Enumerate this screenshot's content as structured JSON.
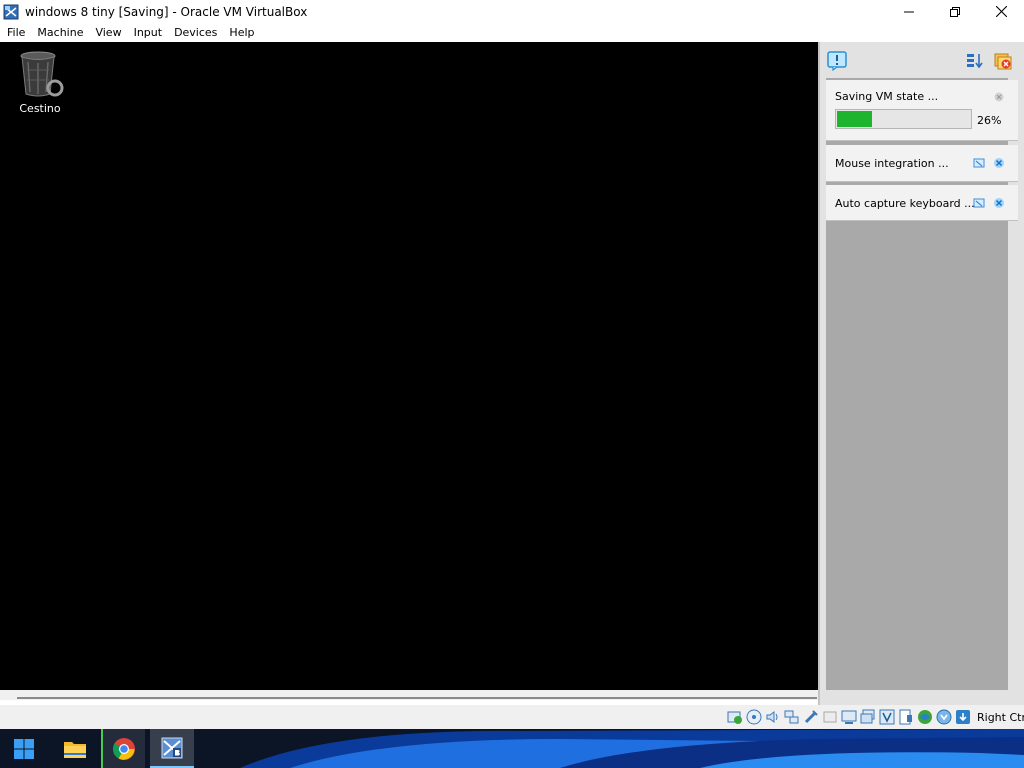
{
  "window": {
    "title": "windows 8 tiny [Saving] - Oracle VM VirtualBox",
    "icon": "virtualbox-icon",
    "controls": [
      "minimize-icon",
      "maximize-icon",
      "close-icon"
    ]
  },
  "menu": {
    "items": [
      "File",
      "Machine",
      "View",
      "Input",
      "Devices",
      "Help"
    ]
  },
  "guest_desktop": {
    "icons": [
      {
        "label": "Cestino",
        "icon": "recycle-bin-icon"
      }
    ]
  },
  "notification_center": {
    "header_icons": [
      "notification-center-icon",
      "sort-notifications-icon",
      "close-all-notifications-icon"
    ],
    "notifications": [
      {
        "text": "Saving VM state ...",
        "progress": 0.26,
        "progress_label": "26%",
        "progress_color": "#1fb42e"
      },
      {
        "text": "Mouse integration ..."
      },
      {
        "text": "Auto capture keyboard ..."
      }
    ]
  },
  "statusbar": {
    "device_icons": [
      "hard-disk-icon",
      "optical-drive-icon",
      "audio-icon",
      "network-icon",
      "usb-icon",
      "shared-folders-icon",
      "display-icon",
      "video-capture-icon",
      "recording-icon",
      "virtualization-icon",
      "cpu-icon",
      "mouse-integration-icon",
      "keyboard-capture-icon"
    ],
    "host_key": "Right Ctrl"
  },
  "taskbar": {
    "apps": [
      "windows-start-icon",
      "file-explorer-icon",
      "chrome-icon",
      "virtualbox-taskbar-icon"
    ],
    "accent": "#0067c0"
  }
}
